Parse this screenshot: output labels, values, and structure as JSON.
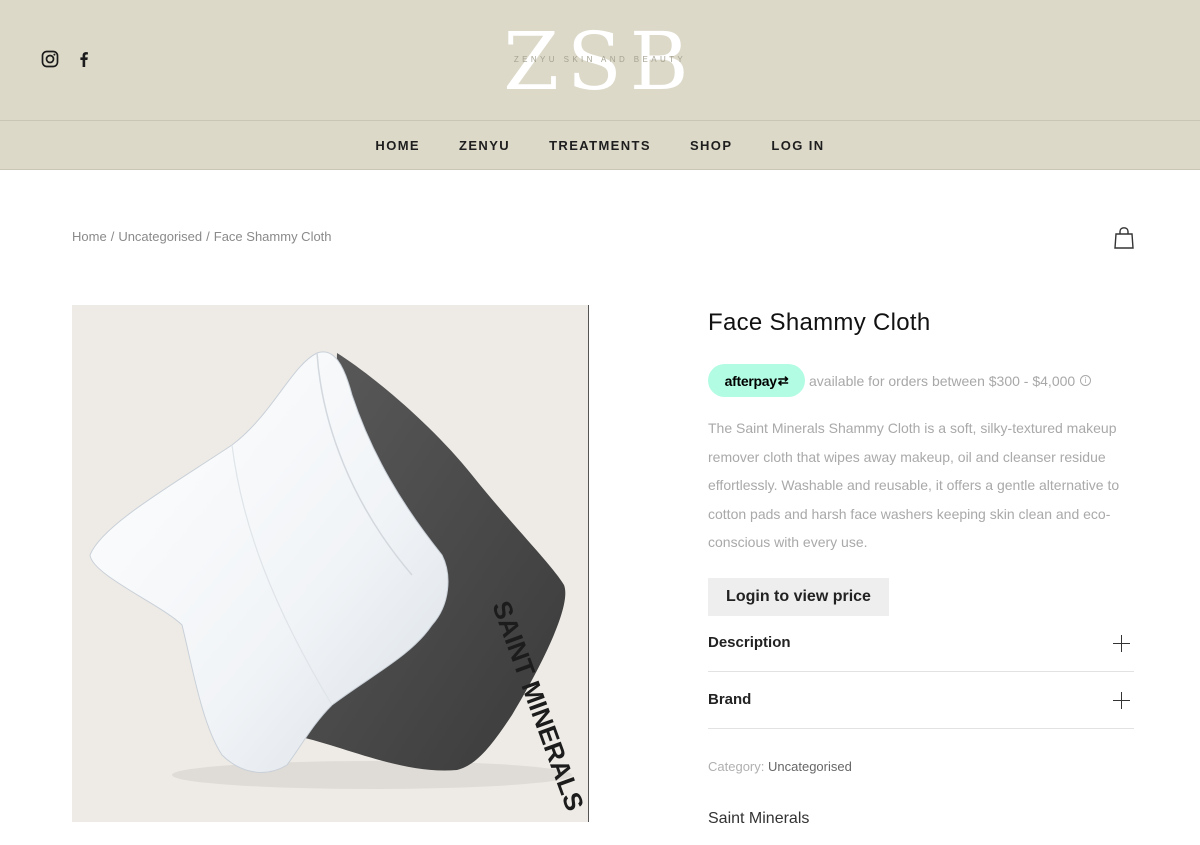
{
  "header": {
    "social": [
      {
        "icon": "instagram-icon"
      },
      {
        "icon": "facebook-icon"
      }
    ],
    "logo": {
      "mark": "ZSB",
      "tagline": "ZENYU SKIN AND BEAUTY"
    },
    "nav": [
      "HOME",
      "ZENYU",
      "TREATMENTS",
      "SHOP",
      "LOG IN"
    ],
    "background": "#dcd9c9"
  },
  "breadcrumb": {
    "items": [
      "Home",
      "Uncategorised",
      "Face Shammy Cloth"
    ],
    "separator": "/"
  },
  "cart": {
    "icon": "shopping-bag-icon"
  },
  "product": {
    "title": "Face Shammy Cloth",
    "afterpay": {
      "logo_text": "afterpay",
      "text": "available for orders between $300 - $4,000",
      "info_icon": "info-icon",
      "color": "#b2fce4"
    },
    "description": "The Saint Minerals Shammy Cloth is a soft, silky-textured makeup remover cloth that wipes away makeup, oil and cleanser residue effortlessly. Washable and reusable, it offers a gentle alternative to cotton pads and harsh face washers keeping skin clean and eco-conscious with every use.",
    "login_button": "Login to view price",
    "accordions": [
      {
        "label": "Description"
      },
      {
        "label": "Brand"
      }
    ],
    "category": {
      "label": "Category:",
      "value": "Uncategorised"
    },
    "brand": "Saint Minerals",
    "image_alt_print": "SAINT MINERALS"
  }
}
